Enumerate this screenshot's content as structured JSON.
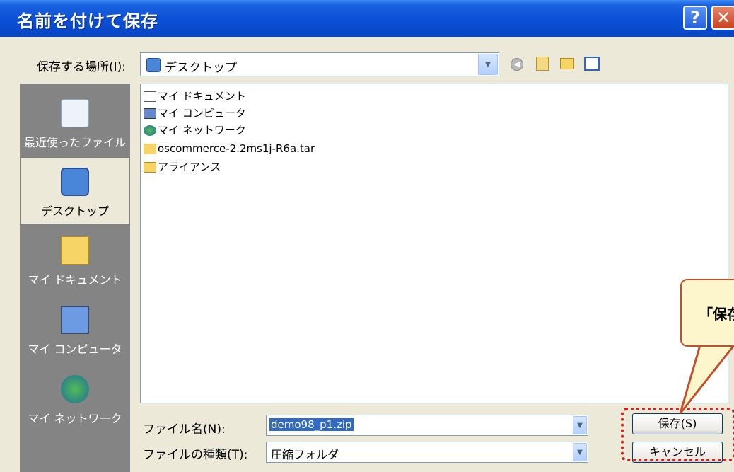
{
  "window": {
    "title": "名前を付けて保存",
    "help_glyph": "?",
    "close_glyph": "✕"
  },
  "save_in": {
    "label": "保存する場所(I):",
    "value": "デスクトップ"
  },
  "places": [
    {
      "label": "最近使ったファイル",
      "icon": "recent-icon"
    },
    {
      "label": "デスクトップ",
      "icon": "desktop-icon",
      "selected": true
    },
    {
      "label": "マイ ドキュメント",
      "icon": "my-documents-icon"
    },
    {
      "label": "マイ コンピュータ",
      "icon": "my-computer-icon"
    },
    {
      "label": "マイ ネットワーク",
      "icon": "my-network-icon"
    }
  ],
  "files": [
    {
      "name": "マイ ドキュメント",
      "icon": "documents-folder-icon"
    },
    {
      "name": "マイ コンピュータ",
      "icon": "computer-icon"
    },
    {
      "name": "マイ ネットワーク",
      "icon": "network-icon"
    },
    {
      "name": "oscommerce-2.2ms1j-R6a.tar",
      "icon": "folder-icon"
    },
    {
      "name": "アライアンス",
      "icon": "folder-icon"
    }
  ],
  "filename": {
    "label": "ファイル名(N):",
    "value": "demo98_p1.zip"
  },
  "filetype": {
    "label": "ファイルの種類(T):",
    "value": "圧縮フォルダ"
  },
  "buttons": {
    "save": "保存(S)",
    "cancel": "キャンセル"
  },
  "callout": {
    "text": "「保存"
  }
}
